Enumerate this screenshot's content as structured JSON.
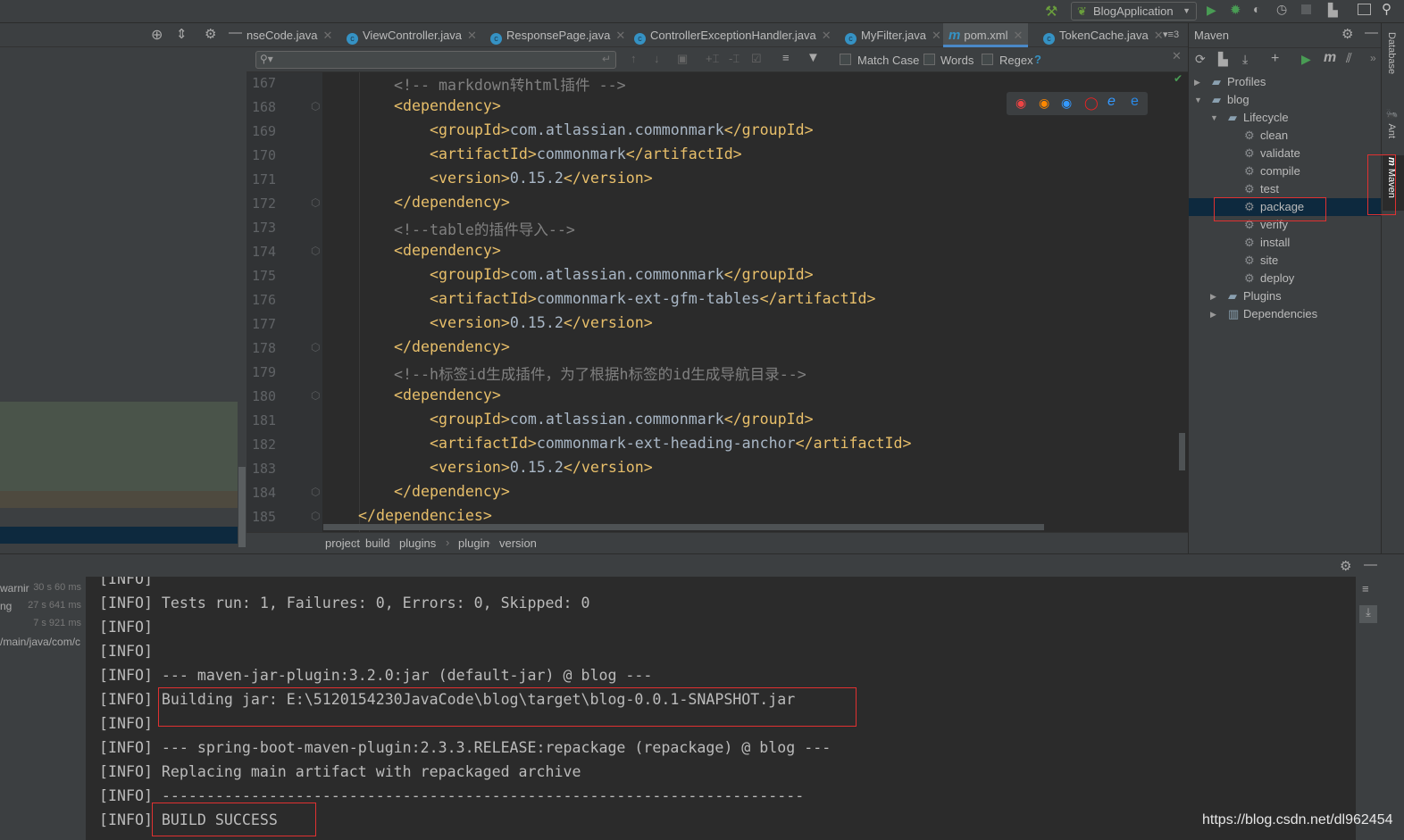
{
  "toolbar": {
    "run_config": "BlogApplication"
  },
  "tabs": [
    {
      "label": "nseCode.java",
      "icon": "class"
    },
    {
      "label": "ViewController.java",
      "icon": "class"
    },
    {
      "label": "ResponsePage.java",
      "icon": "class"
    },
    {
      "label": "ControllerExceptionHandler.java",
      "icon": "class"
    },
    {
      "label": "MyFilter.java",
      "icon": "class"
    },
    {
      "label": "pom.xml",
      "icon": "maven",
      "active": true
    },
    {
      "label": "TokenCache.java",
      "icon": "class"
    }
  ],
  "tab_overflow": "3",
  "find": {
    "placeholder": "",
    "match_case": "Match Case",
    "words": "Words",
    "regex": "Regex",
    "help": "?"
  },
  "code": [
    {
      "n": "167",
      "i": 2,
      "s": [
        [
          "cm",
          "<!-- markdown转html插件 -->"
        ]
      ]
    },
    {
      "n": "168",
      "i": 2,
      "s": [
        [
          "tg",
          "<dependency>"
        ]
      ]
    },
    {
      "n": "169",
      "i": 3,
      "s": [
        [
          "tg",
          "<groupId>"
        ],
        [
          "tx",
          "com.atlassian.commonmark"
        ],
        [
          "tg",
          "</groupId>"
        ]
      ]
    },
    {
      "n": "170",
      "i": 3,
      "s": [
        [
          "tg",
          "<artifactId>"
        ],
        [
          "tx",
          "commonmark"
        ],
        [
          "tg",
          "</artifactId>"
        ]
      ]
    },
    {
      "n": "171",
      "i": 3,
      "s": [
        [
          "tg",
          "<version>"
        ],
        [
          "tx",
          "0.15.2"
        ],
        [
          "tg",
          "</version>"
        ]
      ]
    },
    {
      "n": "172",
      "i": 2,
      "s": [
        [
          "tg",
          "</dependency>"
        ]
      ]
    },
    {
      "n": "173",
      "i": 2,
      "s": [
        [
          "cm",
          "<!--table的插件导入-->"
        ]
      ]
    },
    {
      "n": "174",
      "i": 2,
      "s": [
        [
          "tg",
          "<dependency>"
        ]
      ]
    },
    {
      "n": "175",
      "i": 3,
      "s": [
        [
          "tg",
          "<groupId>"
        ],
        [
          "tx",
          "com.atlassian.commonmark"
        ],
        [
          "tg",
          "</groupId>"
        ]
      ]
    },
    {
      "n": "176",
      "i": 3,
      "s": [
        [
          "tg",
          "<artifactId>"
        ],
        [
          "tx",
          "commonmark-ext-gfm-tables"
        ],
        [
          "tg",
          "</artifactId>"
        ]
      ]
    },
    {
      "n": "177",
      "i": 3,
      "s": [
        [
          "tg",
          "<version>"
        ],
        [
          "tx",
          "0.15.2"
        ],
        [
          "tg",
          "</version>"
        ]
      ]
    },
    {
      "n": "178",
      "i": 2,
      "s": [
        [
          "tg",
          "</dependency>"
        ]
      ]
    },
    {
      "n": "179",
      "i": 2,
      "s": [
        [
          "cm",
          "<!--h标签id生成插件，为了根据h标签的id生成导航目录-->"
        ]
      ]
    },
    {
      "n": "180",
      "i": 2,
      "s": [
        [
          "tg",
          "<dependency>"
        ]
      ]
    },
    {
      "n": "181",
      "i": 3,
      "s": [
        [
          "tg",
          "<groupId>"
        ],
        [
          "tx",
          "com.atlassian.commonmark"
        ],
        [
          "tg",
          "</groupId>"
        ]
      ]
    },
    {
      "n": "182",
      "i": 3,
      "s": [
        [
          "tg",
          "<artifactId>"
        ],
        [
          "tx",
          "commonmark-ext-heading-anchor"
        ],
        [
          "tg",
          "</artifactId>"
        ]
      ]
    },
    {
      "n": "183",
      "i": 3,
      "s": [
        [
          "tg",
          "<version>"
        ],
        [
          "tx",
          "0.15.2"
        ],
        [
          "tg",
          "</version>"
        ]
      ]
    },
    {
      "n": "184",
      "i": 2,
      "s": [
        [
          "tg",
          "</dependency>"
        ]
      ]
    },
    {
      "n": "185",
      "i": 1,
      "s": [
        [
          "tg",
          "</dependencies>"
        ]
      ]
    }
  ],
  "breadcrumb": [
    "project",
    "build",
    "plugins",
    "plugin",
    "version"
  ],
  "maven": {
    "title": "Maven",
    "tree": [
      {
        "label": "Profiles",
        "level": 0,
        "arrow": "▶",
        "icon": "folder"
      },
      {
        "label": "blog",
        "level": 0,
        "arrow": "▼",
        "icon": "maven-module"
      },
      {
        "label": "Lifecycle",
        "level": 1,
        "arrow": "▼",
        "icon": "folder"
      },
      {
        "label": "clean",
        "level": 2,
        "icon": "gear"
      },
      {
        "label": "validate",
        "level": 2,
        "icon": "gear"
      },
      {
        "label": "compile",
        "level": 2,
        "icon": "gear"
      },
      {
        "label": "test",
        "level": 2,
        "icon": "gear"
      },
      {
        "label": "package",
        "level": 2,
        "icon": "gear",
        "selected": true
      },
      {
        "label": "verify",
        "level": 2,
        "icon": "gear"
      },
      {
        "label": "install",
        "level": 2,
        "icon": "gear"
      },
      {
        "label": "site",
        "level": 2,
        "icon": "gear"
      },
      {
        "label": "deploy",
        "level": 2,
        "icon": "gear"
      },
      {
        "label": "Plugins",
        "level": 1,
        "arrow": "▶",
        "icon": "folder"
      },
      {
        "label": "Dependencies",
        "level": 1,
        "arrow": "▶",
        "icon": "library"
      }
    ]
  },
  "side_tabs": {
    "database": "Database",
    "ant": "Ant",
    "maven": "Maven"
  },
  "run_tree": [
    {
      "label": "warnir",
      "time": "30 s 60 ms"
    },
    {
      "label": "ng",
      "time": "27 s 641 ms"
    },
    {
      "label": "",
      "time": "7 s 921 ms"
    },
    {
      "label": "/main/java/com/c",
      "time": ""
    }
  ],
  "console": [
    "[INFO]",
    "[INFO] Tests run: 1, Failures: 0, Errors: 0, Skipped: 0",
    "[INFO]",
    "[INFO]",
    "[INFO] --- maven-jar-plugin:3.2.0:jar (default-jar) @ blog ---",
    "[INFO] Building jar: E:\\5120154230JavaCode\\blog\\target\\blog-0.0.1-SNAPSHOT.jar",
    "[INFO]",
    "[INFO] --- spring-boot-maven-plugin:2.3.3.RELEASE:repackage (repackage) @ blog ---",
    "[INFO] Replacing main artifact with repackaged archive",
    "[INFO] ------------------------------------------------------------------------",
    "[INFO] BUILD SUCCESS"
  ],
  "watermark": "https://blog.csdn.net/dl962454",
  "colors": {
    "tag": "#e8bf6a",
    "comment": "#808080",
    "text": "#a9b7c6",
    "highlight": "#e03131",
    "selection": "#0d293e"
  }
}
